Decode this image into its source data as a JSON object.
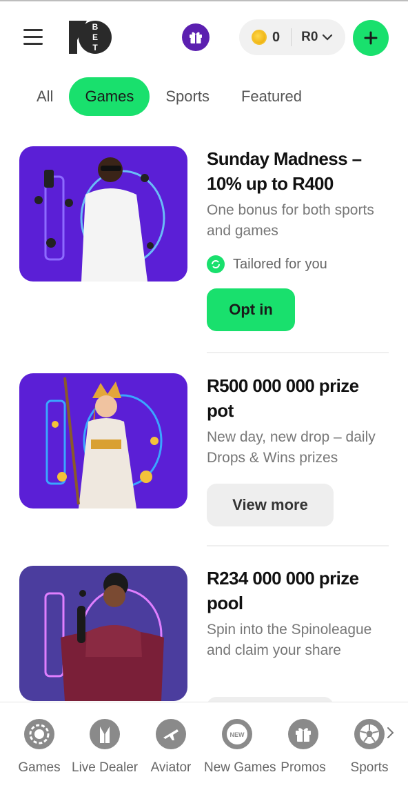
{
  "header": {
    "coin_count": "0",
    "currency": "R0",
    "icons": [
      "hamburger-menu-icon",
      "10bet-logo",
      "gift-icon",
      "coin-icon",
      "chevron-down-icon",
      "plus-icon"
    ],
    "logo_text": "10BET",
    "colors": {
      "accent_green": "#19e06d",
      "gift_purple": "#5b1fb0"
    }
  },
  "tabs": [
    {
      "label": "All",
      "active": false
    },
    {
      "label": "Games",
      "active": true
    },
    {
      "label": "Sports",
      "active": false
    },
    {
      "label": "Featured",
      "active": false
    }
  ],
  "promos": [
    {
      "title": "Sunday Madness – 10% up to R400",
      "description": "One bonus for both sports and games",
      "tag": "Tailored for you",
      "button": "Opt in",
      "button_style": "primary",
      "image_bg": "#5b1fd6"
    },
    {
      "title": "R500 000 000 prize pot",
      "description": "New day, new drop – daily Drops & Wins prizes",
      "button": "View more",
      "button_style": "secondary",
      "image_bg": "#5b1fd6"
    },
    {
      "title": "R234 000 000 prize pool",
      "description": "Spin into the Spinoleague and claim your share",
      "image_bg": "#4b3d9e"
    }
  ],
  "bottom_nav": [
    {
      "label": "Games",
      "icon": "poker-chip-icon"
    },
    {
      "label": "Live Dealer",
      "icon": "tuxedo-icon"
    },
    {
      "label": "Aviator",
      "icon": "plane-icon"
    },
    {
      "label": "New Games",
      "icon": "new-badge-icon"
    },
    {
      "label": "Promos",
      "icon": "gift-icon"
    },
    {
      "label": "Sports",
      "icon": "soccer-ball-icon"
    }
  ]
}
